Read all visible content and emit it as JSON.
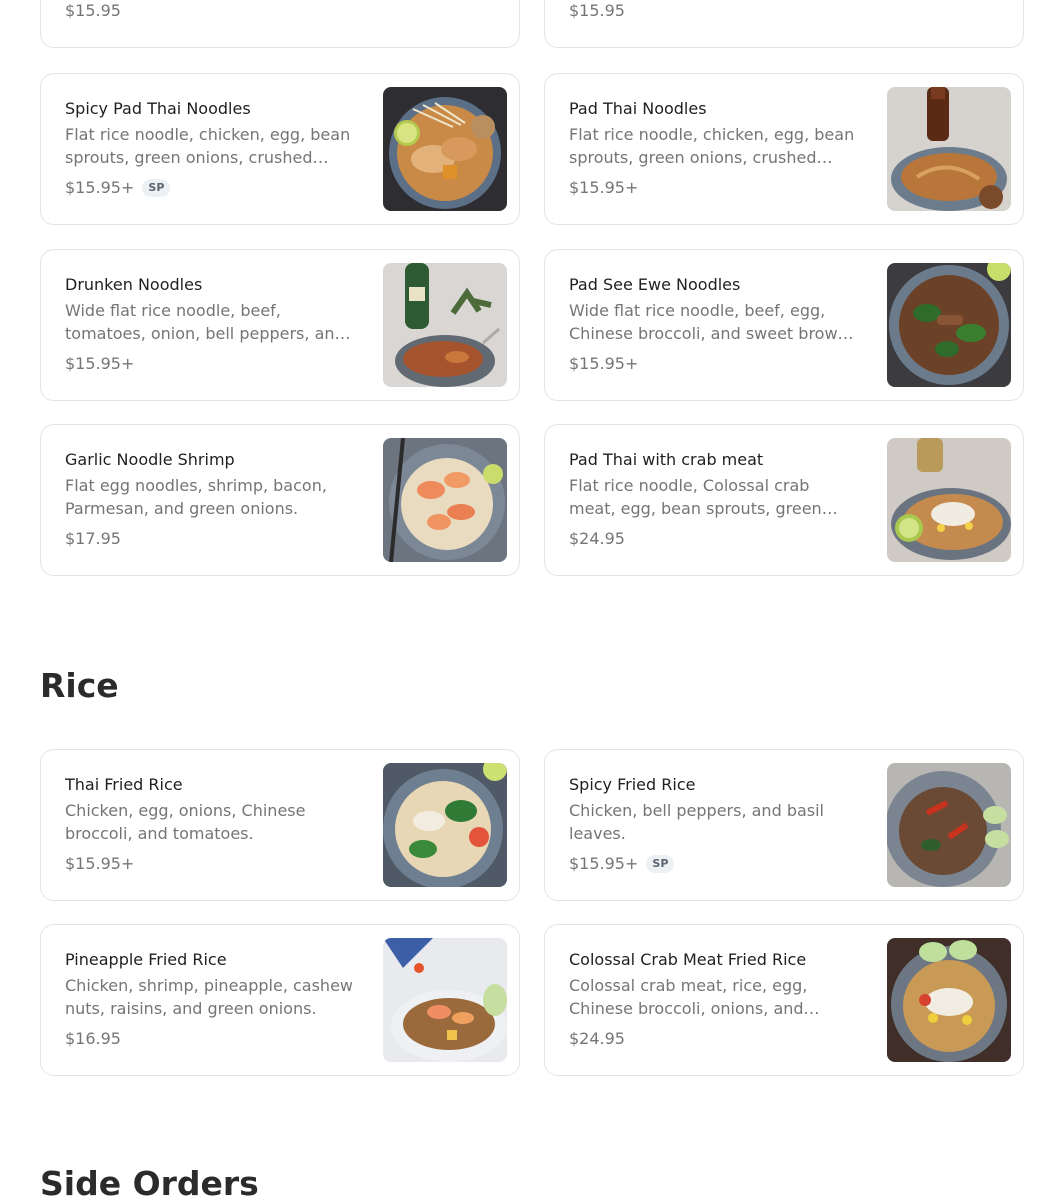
{
  "partial_row": [
    {
      "price": "$15.95"
    },
    {
      "price": "$15.95"
    }
  ],
  "noodles": [
    {
      "name": "Spicy Pad Thai Noodles",
      "desc": "Flat rice noodle, chicken, egg, bean sprouts, green onions, crushed peanuts, and lime.",
      "price": "$15.95+",
      "badge": "SP",
      "photo": "spicy-pad-thai-photo"
    },
    {
      "name": "Pad Thai Noodles",
      "desc": "Flat rice noodle, chicken, egg, bean sprouts, green onions, crushed peanuts, and lime.",
      "price": "$15.95+",
      "photo": "pad-thai-photo"
    },
    {
      "name": "Drunken Noodles",
      "desc": "Wide flat rice noodle, beef, tomatoes, onion, bell peppers, and basil leaves.",
      "price": "$15.95+",
      "photo": "drunken-noodles-photo"
    },
    {
      "name": "Pad See Ewe Noodles",
      "desc": "Wide flat rice noodle, beef, egg, Chinese broccoli, and sweet brown sauce.",
      "price": "$15.95+",
      "photo": "pad-see-ewe-photo"
    },
    {
      "name": "Garlic Noodle Shrimp",
      "desc": "Flat egg noodles, shrimp, bacon, Parmesan, and green onions.",
      "price": "$17.95",
      "photo": "garlic-noodle-shrimp-photo"
    },
    {
      "name": "Pad Thai with crab meat",
      "desc": "Flat rice noodle, Colossal crab meat, egg, bean sprouts, green onions, and crushed peanuts.",
      "price": "$24.95",
      "photo": "pad-thai-crab-photo"
    }
  ],
  "rice_section": {
    "title": "Rice",
    "items": [
      {
        "name": "Thai Fried Rice",
        "desc": "Chicken, egg, onions, Chinese broccoli, and tomatoes.",
        "price": "$15.95+",
        "photo": "thai-fried-rice-photo"
      },
      {
        "name": "Spicy Fried Rice",
        "desc": "Chicken, bell peppers, and basil leaves.",
        "price": "$15.95+",
        "badge": "SP",
        "photo": "spicy-fried-rice-photo"
      },
      {
        "name": "Pineapple Fried Rice",
        "desc": "Chicken, shrimp, pineapple, cashew nuts, raisins, and green onions.",
        "price": "$16.95",
        "photo": "pineapple-fried-rice-photo"
      },
      {
        "name": "Colossal Crab Meat Fried Rice",
        "desc": "Colossal crab meat, rice, egg, Chinese broccoli, onions, and tomatoes.",
        "price": "$24.95",
        "photo": "crab-fried-rice-photo"
      }
    ]
  },
  "next_section": {
    "title": "Side Orders"
  }
}
